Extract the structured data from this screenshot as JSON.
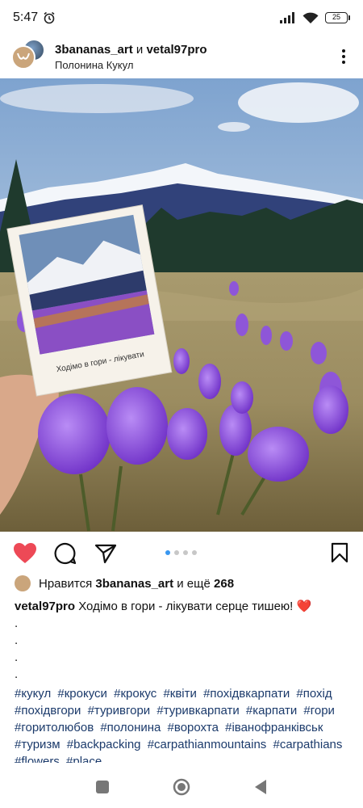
{
  "status_bar": {
    "time": "5:47",
    "battery": "25",
    "icons": [
      "alarm-icon",
      "signal-icon",
      "wifi-icon",
      "battery-icon"
    ]
  },
  "post": {
    "user_primary": "3bananas_art",
    "conjunction": "и",
    "user_secondary": "vetal97pro",
    "location": "Полонина Кукул",
    "carousel": {
      "count": 4,
      "active": 1
    },
    "photo_card_text": "Ходімо в гори - лікувати"
  },
  "likes": {
    "prefix": "Нравится",
    "user": "3bananas_art",
    "middle": "и ещё",
    "count": "268"
  },
  "caption": {
    "author": "vetal97pro",
    "text": "Ходімо в гори - лікувати серце тишею! ❤️",
    "dot_lines": [
      ".",
      ".",
      ".",
      "."
    ],
    "hashtags": [
      "#кукул",
      "#крокуси",
      "#крокус",
      "#квіти",
      "#похідвкарпати",
      "#похід",
      "#похідвгори",
      "#туривгори",
      "#туривкарпати",
      "#карпати",
      "#гори",
      "#горитолюбов",
      "#полонина",
      "#ворохта",
      "#іванофранківськ",
      "#туризм",
      "#backpacking",
      "#carpathianmountains",
      "#carpathians",
      "#flowers",
      "#place"
    ]
  },
  "colors": {
    "heart": "#ed4956",
    "hashtag": "#1b3a6b",
    "dot_active": "#3897f0"
  }
}
